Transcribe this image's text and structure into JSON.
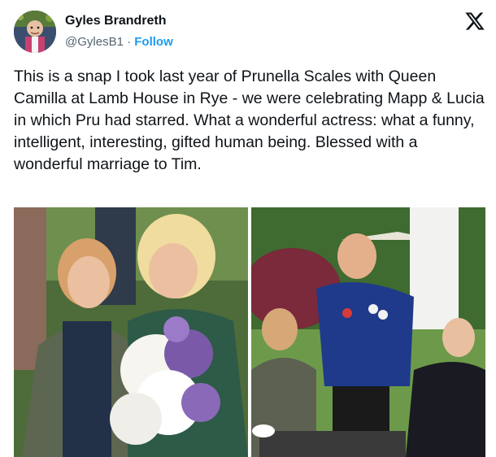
{
  "author": {
    "name": "Gyles Brandreth",
    "handle": "@GylesB1",
    "separator": " · ",
    "follow_label": "Follow"
  },
  "icons": {
    "platform": "x-logo-icon"
  },
  "tweet": {
    "text": "This is a snap I took last year of Prunella Scales with Queen Camilla at Lamb House in Rye - we were celebrating Mapp & Lucia in which Pru had starred. What a wonderful actress: what a funny, intelligent, interesting, gifted human being. Blessed with a wonderful marriage to Tim."
  },
  "media": {
    "count": 2
  },
  "colors": {
    "link": "#1d9bf0",
    "text": "#0f1419",
    "secondary": "#536471"
  }
}
